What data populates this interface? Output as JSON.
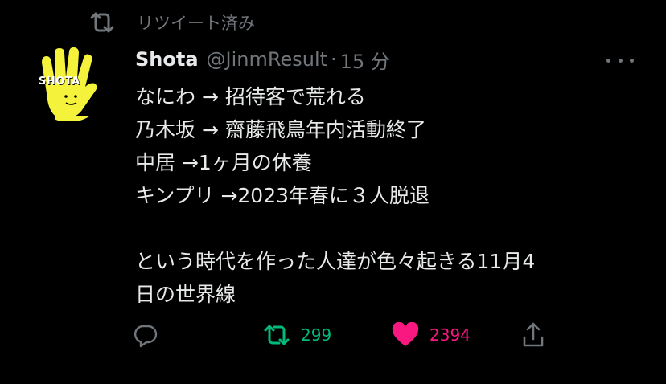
{
  "retweet_header": {
    "icon": "retweet-icon",
    "text": "リツイート済み"
  },
  "tweet": {
    "avatar_text": "SHOTA",
    "display_name": "Shota",
    "handle": "@JinmResult",
    "separator": "·",
    "time": "15 分",
    "lines": [
      "なにわ → 招待客で荒れる",
      "乃木坂 → 齋藤飛鳥年内活動終了",
      "中居 →1ヶ月の休養",
      "キンプリ →2023年春に３人脱退",
      "",
      "という時代を作った人達が色々起きる11月4",
      "日の世界線"
    ]
  },
  "actions": {
    "reply": {
      "icon": "reply-icon"
    },
    "retweet": {
      "icon": "retweet-icon",
      "count": "299",
      "color": "#00ba7c",
      "active": true
    },
    "like": {
      "icon": "heart-icon",
      "count": "2394",
      "color": "#f91880",
      "active": true
    },
    "share": {
      "icon": "share-icon"
    }
  },
  "colors": {
    "background": "#000000",
    "text": "#e7e9ea",
    "secondary": "#71767b",
    "avatar_yellow": "#f4f23a"
  }
}
